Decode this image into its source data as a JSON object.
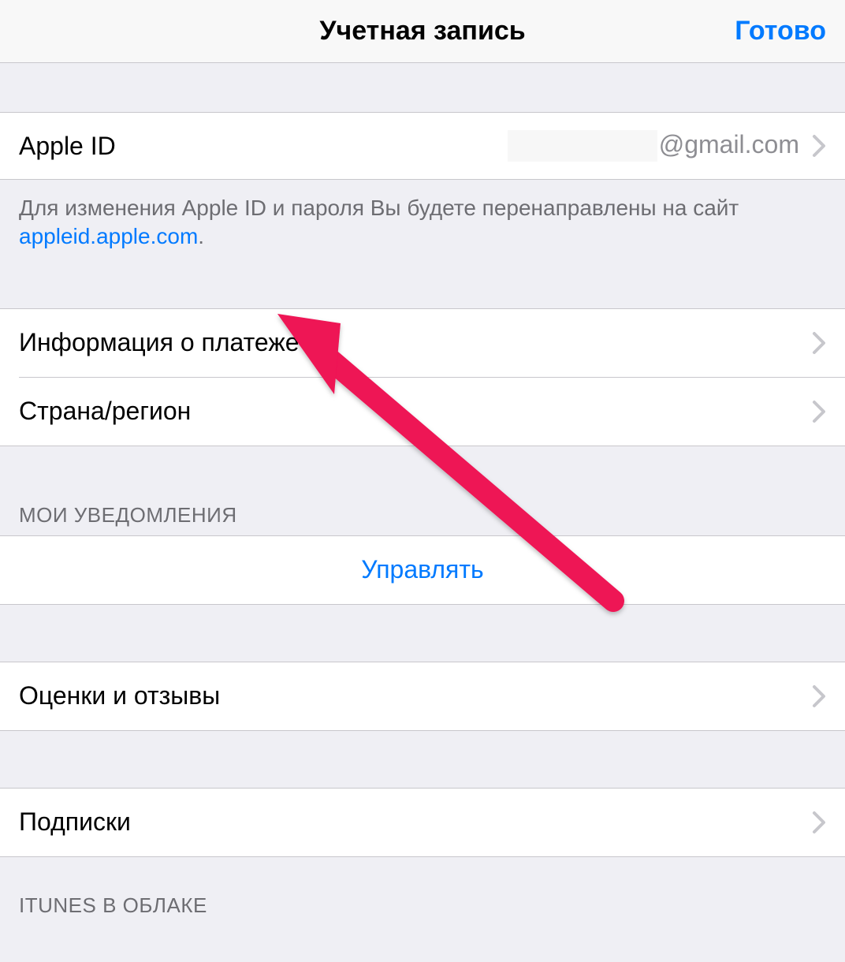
{
  "navbar": {
    "title": "Учетная запись",
    "done": "Готово"
  },
  "apple_id": {
    "label": "Apple ID",
    "value_suffix": "@gmail.com"
  },
  "apple_id_footer": {
    "text_before": "Для изменения Apple ID и пароля Вы будете перенаправлены на сайт ",
    "link_text": "appleid.apple.com",
    "text_after": "."
  },
  "rows": {
    "payment_info": "Информация о платеже",
    "country_region": "Страна/регион",
    "ratings_reviews": "Оценки и отзывы",
    "subscriptions": "Подписки"
  },
  "sections": {
    "my_notifications": "МОИ УВЕДОМЛЕНИЯ",
    "manage": "Управлять",
    "itunes_cloud": "iTUNES В ОБЛАКЕ"
  },
  "colors": {
    "accent": "#007aff",
    "annotation": "#ee1254"
  }
}
